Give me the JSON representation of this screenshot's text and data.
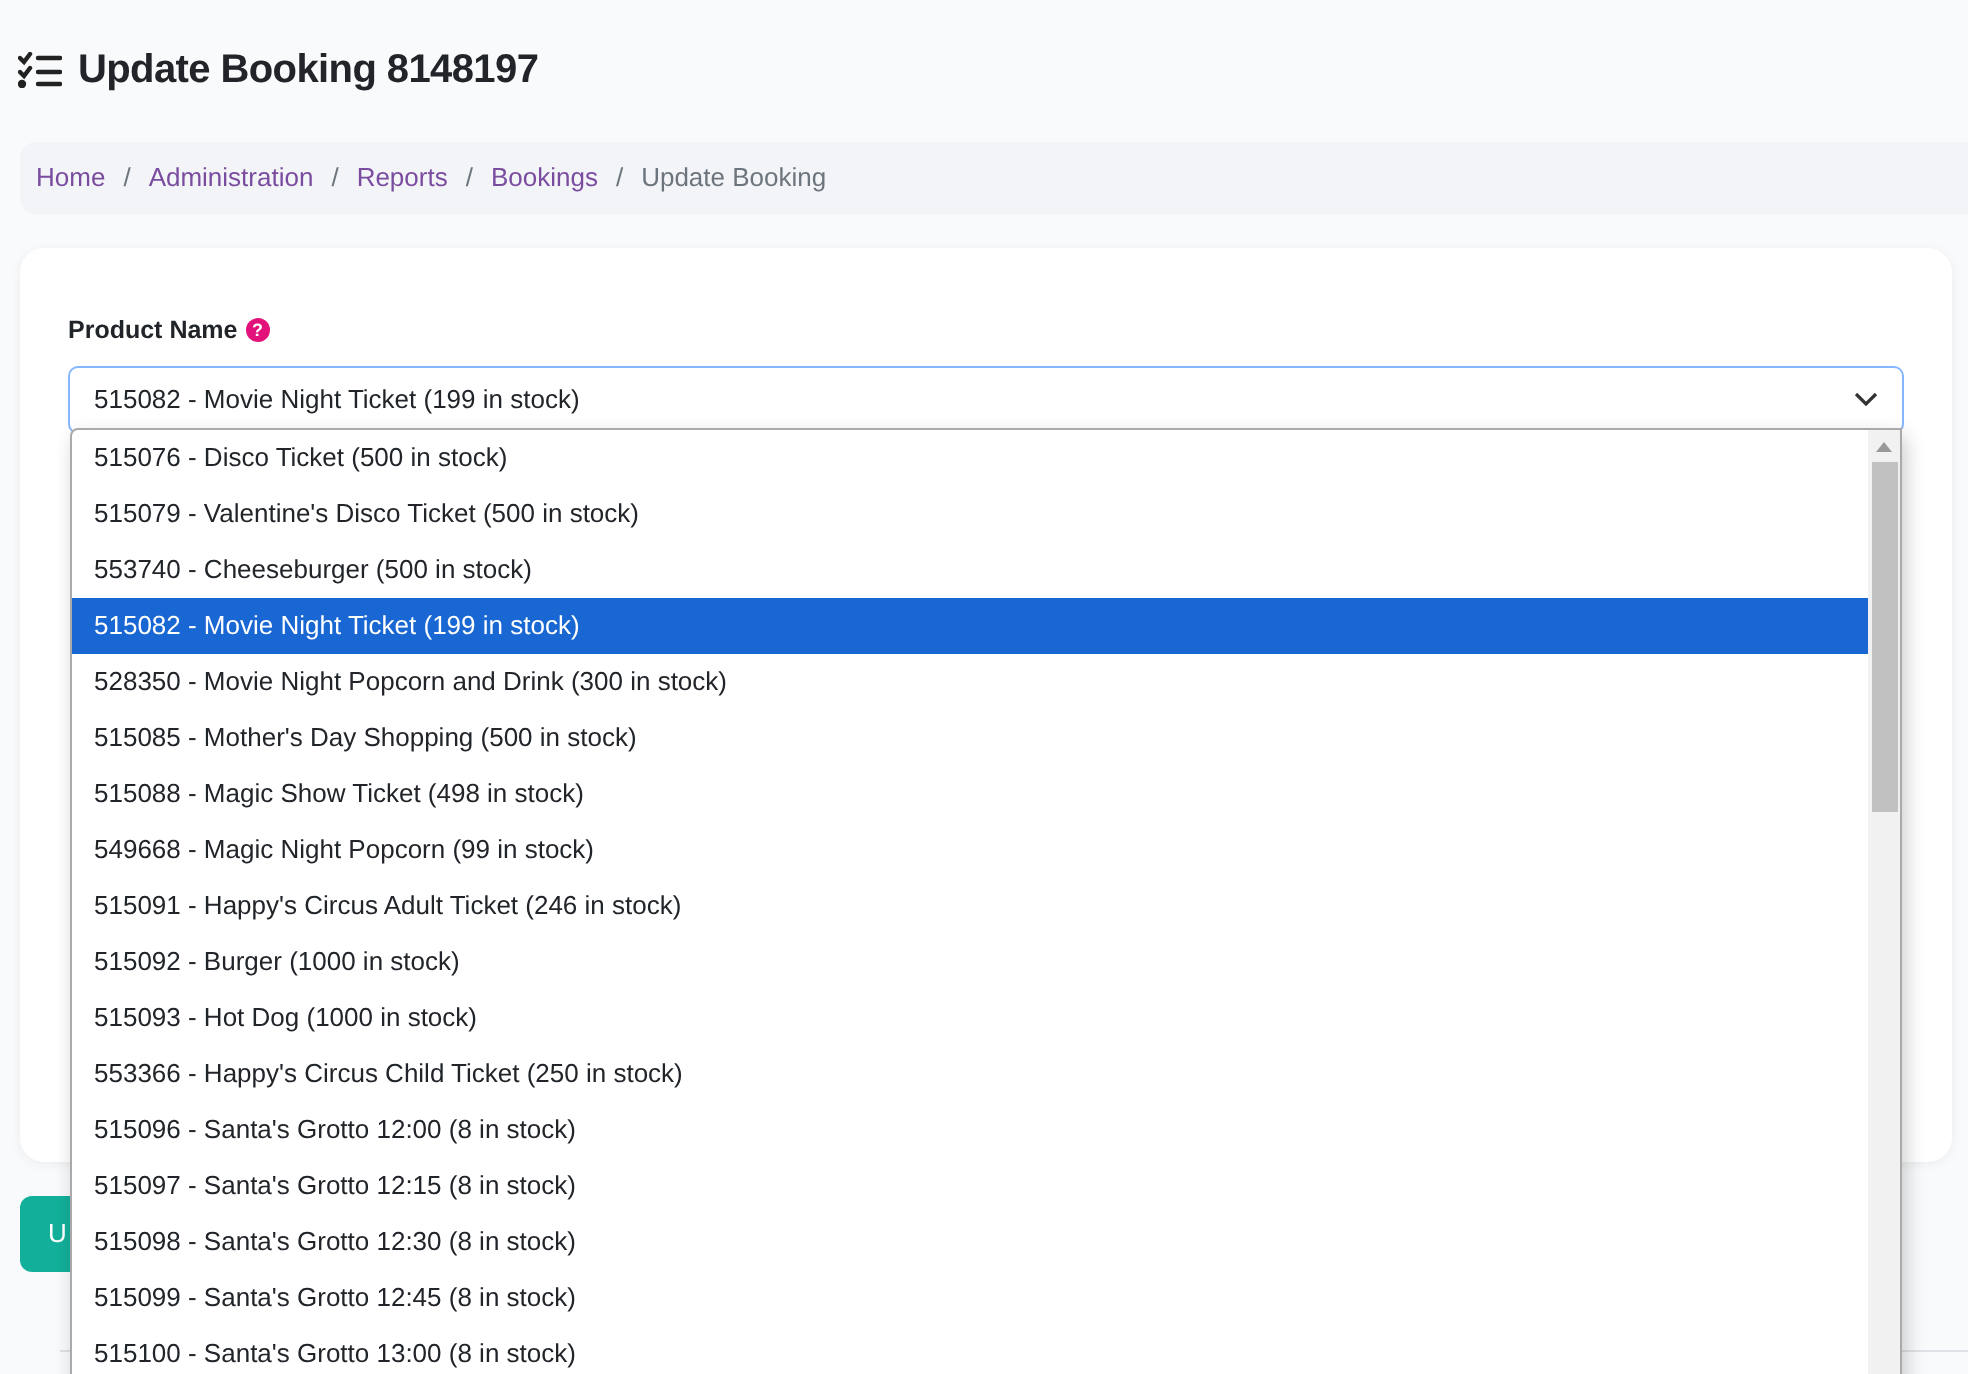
{
  "page_title": "Update Booking 8148197",
  "breadcrumb_separator": "/",
  "breadcrumb": [
    {
      "label": "Home",
      "current": false
    },
    {
      "label": "Administration",
      "current": false
    },
    {
      "label": "Reports",
      "current": false
    },
    {
      "label": "Bookings",
      "current": false
    },
    {
      "label": "Update Booking",
      "current": true
    }
  ],
  "form": {
    "label": "Product Name",
    "help_icon": "?",
    "select_value": "515082 - Movie Night Ticket (199 in stock)",
    "expanded": true,
    "options": [
      {
        "label": "515076 - Disco Ticket (500 in stock)",
        "selected": false
      },
      {
        "label": "515079 - Valentine's Disco Ticket (500 in stock)",
        "selected": false
      },
      {
        "label": "553740 - Cheeseburger (500 in stock)",
        "selected": false
      },
      {
        "label": "515082 - Movie Night Ticket (199 in stock)",
        "selected": true
      },
      {
        "label": "528350 - Movie Night Popcorn and Drink (300 in stock)",
        "selected": false
      },
      {
        "label": "515085 - Mother's Day Shopping (500 in stock)",
        "selected": false
      },
      {
        "label": "515088 - Magic Show Ticket (498 in stock)",
        "selected": false
      },
      {
        "label": "549668 - Magic Night Popcorn (99 in stock)",
        "selected": false
      },
      {
        "label": "515091 - Happy's Circus Adult Ticket (246 in stock)",
        "selected": false
      },
      {
        "label": "515092 - Burger (1000 in stock)",
        "selected": false
      },
      {
        "label": "515093 - Hot Dog (1000 in stock)",
        "selected": false
      },
      {
        "label": "553366 - Happy's Circus Child Ticket (250 in stock)",
        "selected": false
      },
      {
        "label": "515096 - Santa's Grotto 12:00 (8 in stock)",
        "selected": false
      },
      {
        "label": "515097 - Santa's Grotto 12:15 (8 in stock)",
        "selected": false
      },
      {
        "label": "515098 - Santa's Grotto 12:30 (8 in stock)",
        "selected": false
      },
      {
        "label": "515099 - Santa's Grotto 12:45 (8 in stock)",
        "selected": false
      },
      {
        "label": "515100 - Santa's Grotto 13:00 (8 in stock)",
        "selected": false
      }
    ]
  },
  "submit_button": "U"
}
